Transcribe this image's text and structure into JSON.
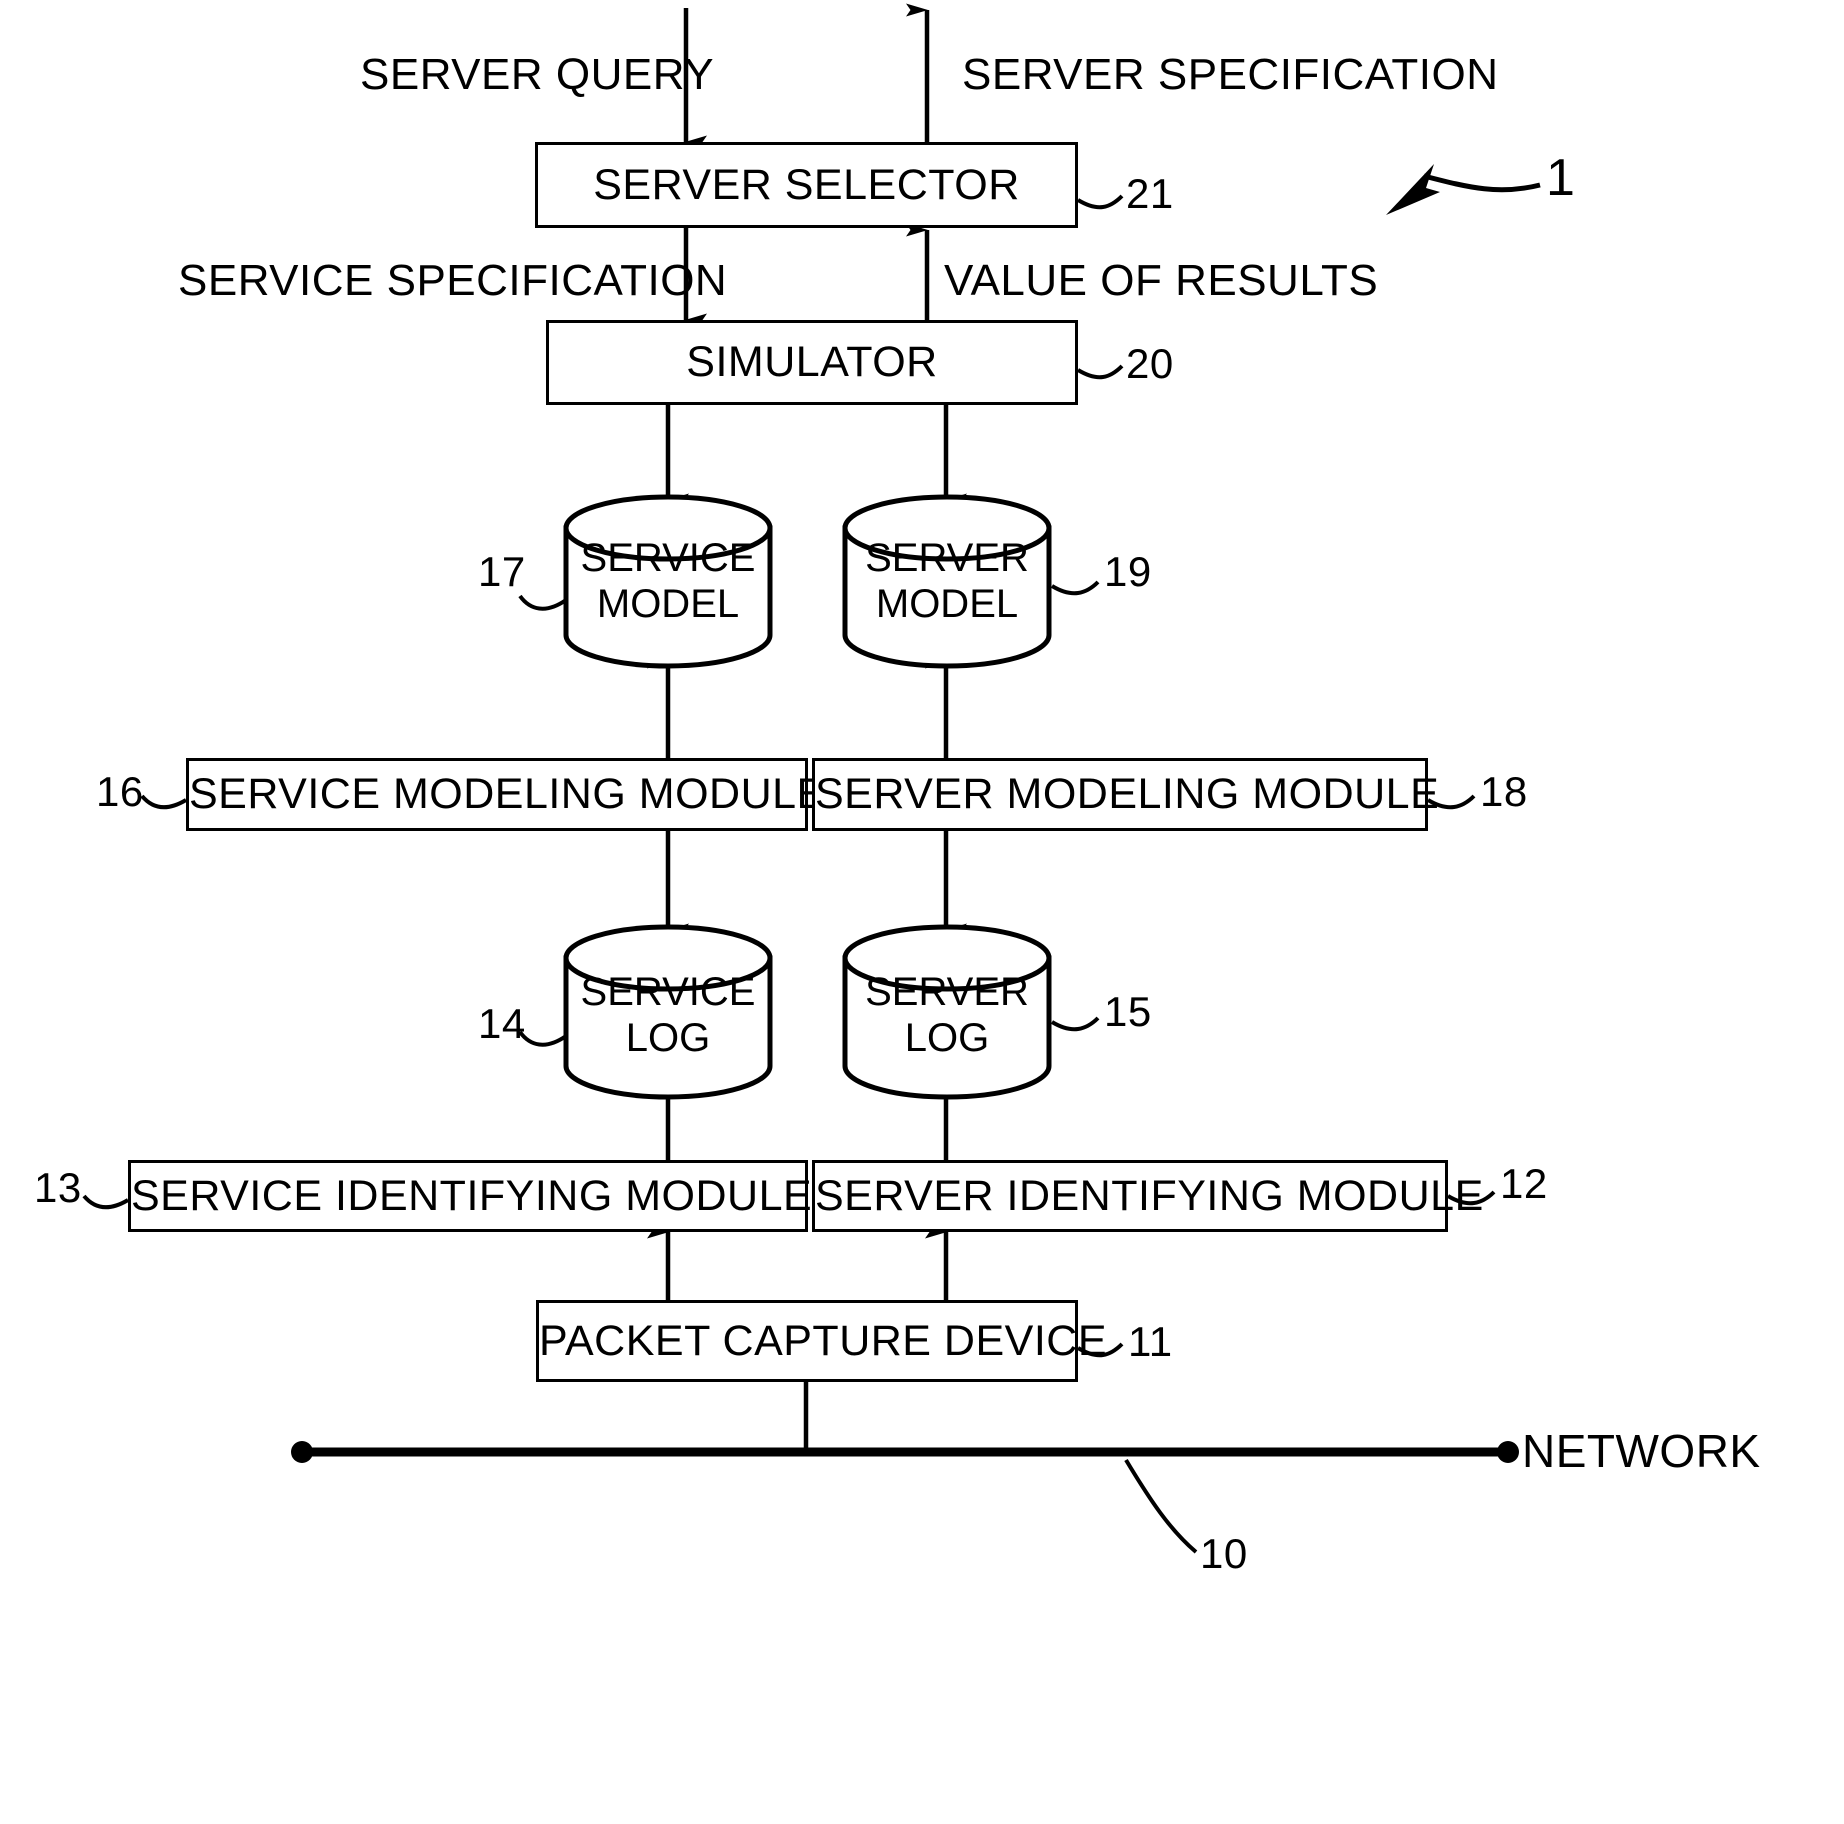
{
  "figure": {
    "reference_numeral": "1",
    "flow_labels": {
      "server_query": "SERVER QUERY",
      "server_specification": "SERVER SPECIFICATION",
      "service_specification": "SERVICE SPECIFICATION",
      "value_of_results": "VALUE OF RESULTS",
      "network": "NETWORK"
    },
    "blocks": [
      {
        "id": "server-selector",
        "label": "SERVER SELECTOR",
        "ref": "21"
      },
      {
        "id": "simulator",
        "label": "SIMULATOR",
        "ref": "20"
      },
      {
        "id": "service-modeling-module",
        "label": "SERVICE MODELING MODULE",
        "ref": "16"
      },
      {
        "id": "server-modeling-module",
        "label": "SERVER MODELING MODULE",
        "ref": "18"
      },
      {
        "id": "service-identifying-module",
        "label": "SERVICE IDENTIFYING MODULE",
        "ref": "13"
      },
      {
        "id": "server-identifying-module",
        "label": "SERVER IDENTIFYING MODULE",
        "ref": "12"
      },
      {
        "id": "packet-capture-device",
        "label": "PACKET CAPTURE DEVICE",
        "ref": "11"
      }
    ],
    "stores": [
      {
        "id": "service-model",
        "line1": "SERVICE",
        "line2": "MODEL",
        "ref": "17"
      },
      {
        "id": "server-model",
        "line1": "SERVER",
        "line2": "MODEL",
        "ref": "19"
      },
      {
        "id": "service-log",
        "line1": "SERVICE",
        "line2": "LOG",
        "ref": "14"
      },
      {
        "id": "server-log",
        "line1": "SERVER",
        "line2": "LOG",
        "ref": "15"
      }
    ],
    "network_ref": "10",
    "colors": {
      "ink": "#000000",
      "paper": "#ffffff"
    }
  }
}
